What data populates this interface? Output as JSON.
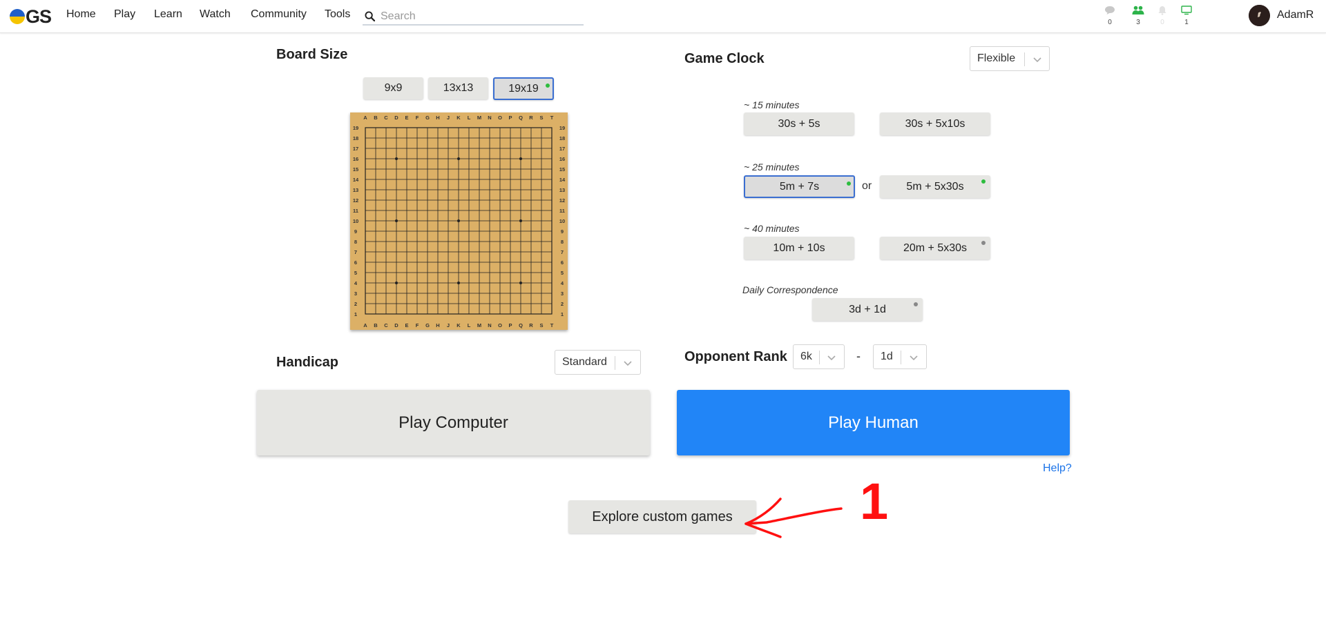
{
  "navbar": {
    "logo_text": "GS",
    "links": [
      "Home",
      "Play",
      "Learn",
      "Watch",
      "Community",
      "Tools"
    ],
    "search_placeholder": "Search",
    "icons": [
      {
        "name": "chat-icon",
        "count": "0"
      },
      {
        "name": "friends-icon",
        "count": "3"
      },
      {
        "name": "notifications-icon",
        "count": "0"
      },
      {
        "name": "games-icon",
        "count": "1"
      }
    ],
    "username": "AdamR"
  },
  "board_size": {
    "title": "Board Size",
    "options": [
      "9x9",
      "13x13",
      "19x19"
    ],
    "selected": "19x19"
  },
  "board": {
    "columns": [
      "A",
      "B",
      "C",
      "D",
      "E",
      "F",
      "G",
      "H",
      "J",
      "K",
      "L",
      "M",
      "N",
      "O",
      "P",
      "Q",
      "R",
      "S",
      "T"
    ],
    "rows": [
      "19",
      "18",
      "17",
      "16",
      "15",
      "14",
      "13",
      "12",
      "11",
      "10",
      "9",
      "8",
      "7",
      "6",
      "5",
      "4",
      "3",
      "2",
      "1"
    ]
  },
  "handicap": {
    "title": "Handicap",
    "value": "Standard"
  },
  "game_clock": {
    "title": "Game Clock",
    "mode": "Flexible",
    "groups": [
      {
        "label": "~ 15 minutes",
        "options": [
          "30s + 5s",
          "30s + 5x10s"
        ]
      },
      {
        "label": "~ 25 minutes",
        "options": [
          "5m + 7s",
          "5m + 5x30s"
        ],
        "separator": "or"
      },
      {
        "label": "~ 40 minutes",
        "options": [
          "10m + 10s",
          "20m + 5x30s"
        ]
      },
      {
        "label": "Daily Correspondence",
        "options": [
          "3d + 1d"
        ]
      }
    ]
  },
  "opponent_rank": {
    "title": "Opponent Rank",
    "min": "6k",
    "separator": "-",
    "max": "1d"
  },
  "actions": {
    "play_computer": "Play Computer",
    "play_human": "Play Human",
    "help": "Help?",
    "explore": "Explore custom games"
  },
  "annotation": {
    "number": "1",
    "color": "#ff1010"
  },
  "colors": {
    "accent": "#2185f7",
    "selected_border": "#3a6ed1",
    "dot_green": "#2dbd3f",
    "dot_gray": "#888888",
    "board_wood": "#dcb066"
  }
}
